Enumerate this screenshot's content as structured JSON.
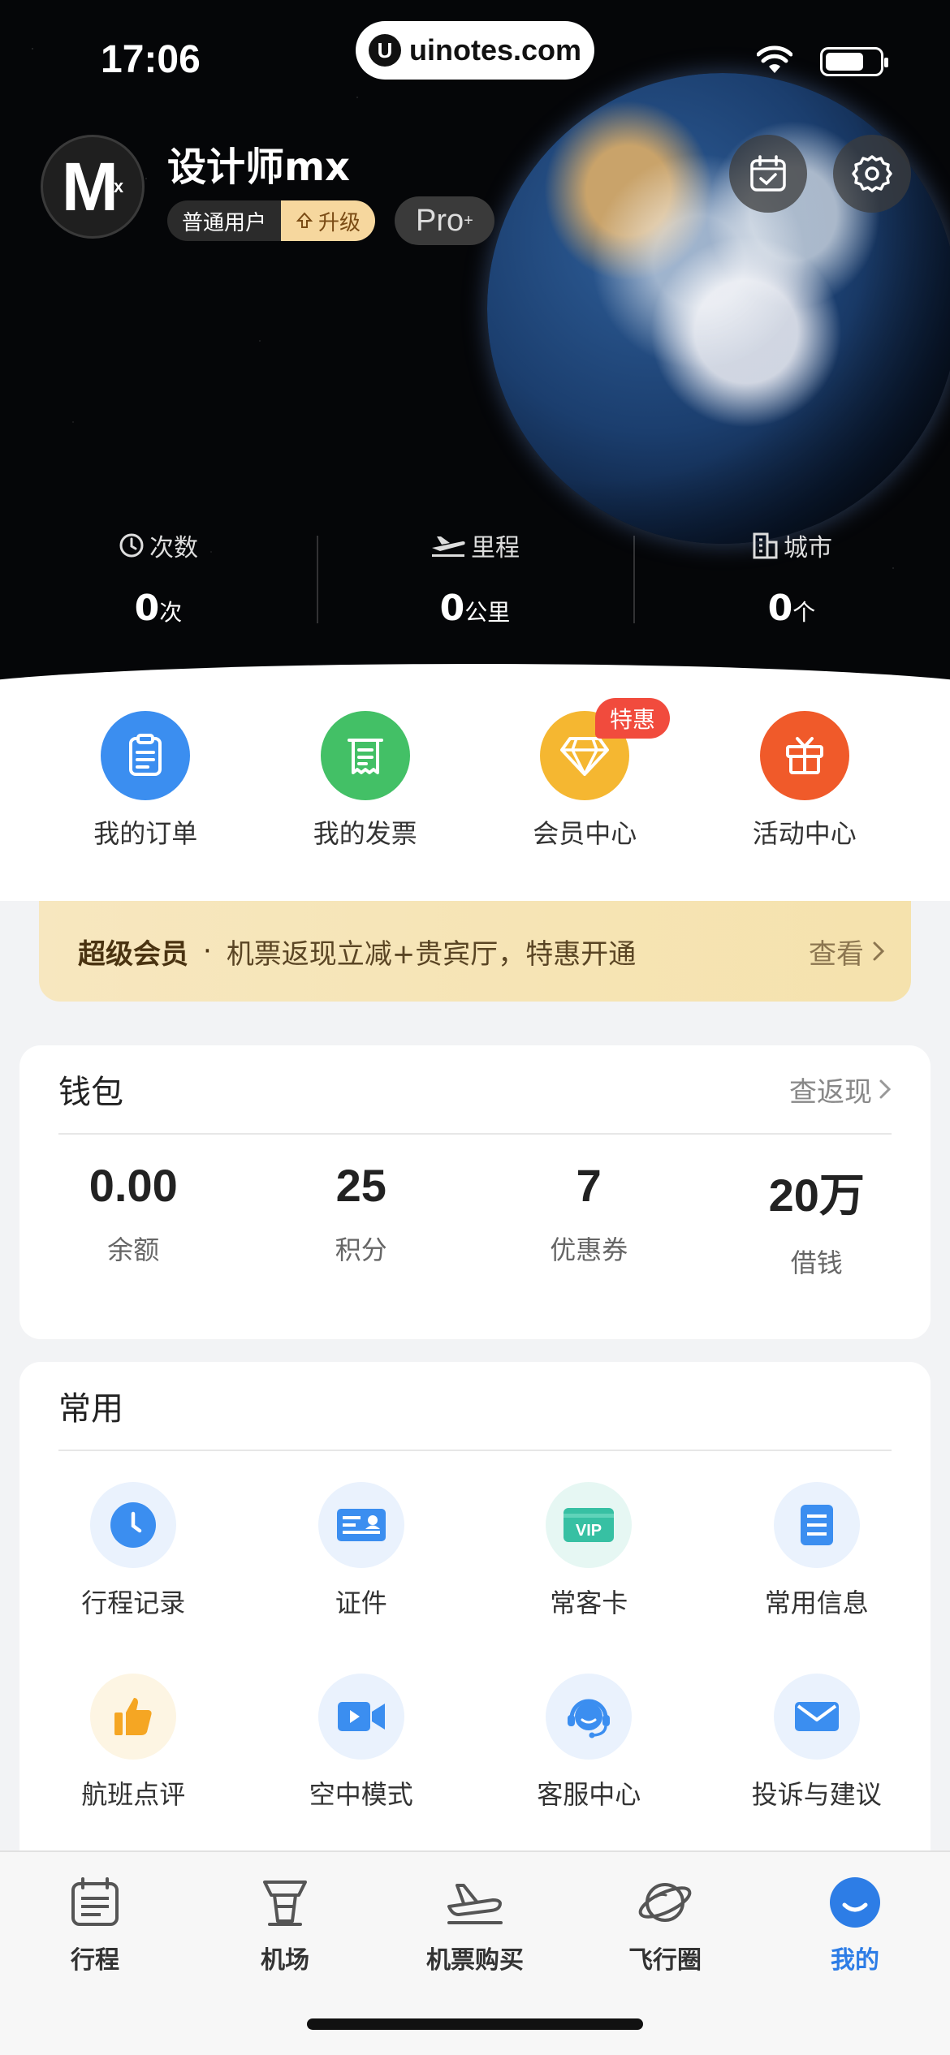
{
  "status_bar": {
    "time": "17:06",
    "url": "uinotes.com"
  },
  "profile": {
    "avatar_text": "M",
    "avatar_sub": "x",
    "name": "设计师mx",
    "level": "普通用户",
    "upgrade": "升级",
    "pro": "Pro",
    "pro_sup": "+"
  },
  "stats": [
    {
      "label": "次数",
      "value": "0",
      "unit": "次",
      "icon": "clock-icon"
    },
    {
      "label": "里程",
      "value": "0",
      "unit": "公里",
      "icon": "plane-icon"
    },
    {
      "label": "城市",
      "value": "0",
      "unit": "个",
      "icon": "building-icon"
    }
  ],
  "quick_menu": [
    {
      "label": "我的订单",
      "icon": "clipboard-icon",
      "color": "#3b8ef0"
    },
    {
      "label": "我的发票",
      "icon": "receipt-icon",
      "color": "#43c066"
    },
    {
      "label": "会员中心",
      "icon": "diamond-icon",
      "color": "#f5b731",
      "tag": "特惠"
    },
    {
      "label": "活动中心",
      "icon": "gift-icon",
      "color": "#f05a2a"
    }
  ],
  "vip_banner": {
    "title": "超级会员",
    "dot": "·",
    "desc": "机票返现立减+贵宾厅，特惠开通",
    "link": "查看"
  },
  "wallet": {
    "title": "钱包",
    "more": "查返现",
    "items": [
      {
        "value": "0.00",
        "label": "余额"
      },
      {
        "value": "25",
        "label": "积分"
      },
      {
        "value": "7",
        "label": "优惠券"
      },
      {
        "value": "20万",
        "label": "借钱"
      }
    ]
  },
  "common": {
    "title": "常用",
    "items": [
      {
        "label": "行程记录",
        "icon": "clock-icon"
      },
      {
        "label": "证件",
        "icon": "id-card-icon"
      },
      {
        "label": "常客卡",
        "icon": "vip-card-icon",
        "text": "VIP"
      },
      {
        "label": "常用信息",
        "icon": "document-icon"
      },
      {
        "label": "航班点评",
        "icon": "thumbs-up-icon"
      },
      {
        "label": "空中模式",
        "icon": "video-camera-icon"
      },
      {
        "label": "客服中心",
        "icon": "headset-icon"
      },
      {
        "label": "投诉与建议",
        "icon": "envelope-icon"
      }
    ]
  },
  "tabbar": [
    {
      "label": "行程",
      "icon": "calendar-icon"
    },
    {
      "label": "机场",
      "icon": "tower-icon"
    },
    {
      "label": "机票购买",
      "icon": "airplane-icon"
    },
    {
      "label": "飞行圈",
      "icon": "planet-icon"
    },
    {
      "label": "我的",
      "icon": "smile-icon",
      "active": true
    }
  ],
  "colors": {
    "accent": "#2d7de6",
    "hot": "#f14b3d",
    "vip_bg": "#f6e4b3"
  }
}
